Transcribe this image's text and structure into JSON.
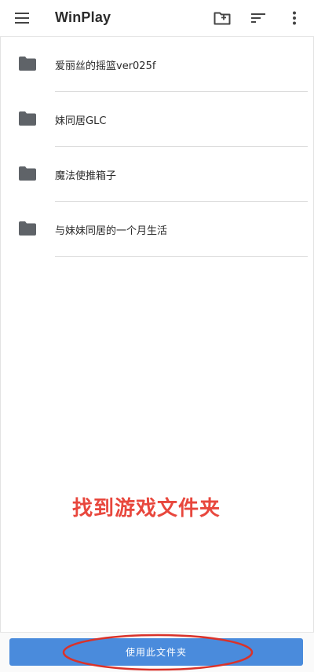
{
  "app_bar": {
    "title": "WinPlay",
    "icons": [
      "menu-icon",
      "create-folder-icon",
      "sort-icon",
      "more-vert-icon"
    ]
  },
  "folders": [
    {
      "name": "爱丽丝的摇篮ver025f",
      "icon": "folder-icon"
    },
    {
      "name": "妹同居GLC",
      "icon": "folder-icon"
    },
    {
      "name": "魔法使推箱子",
      "icon": "folder-icon"
    },
    {
      "name": "与妹妹同居的一个月生活",
      "icon": "folder-icon"
    }
  ],
  "annotation": {
    "text": "找到游戏文件夹",
    "color": "#e8473d"
  },
  "bottom": {
    "use_folder_label": "使用此文件夹",
    "button_color": "#4a8bdc",
    "highlight_color": "#d9322a"
  }
}
